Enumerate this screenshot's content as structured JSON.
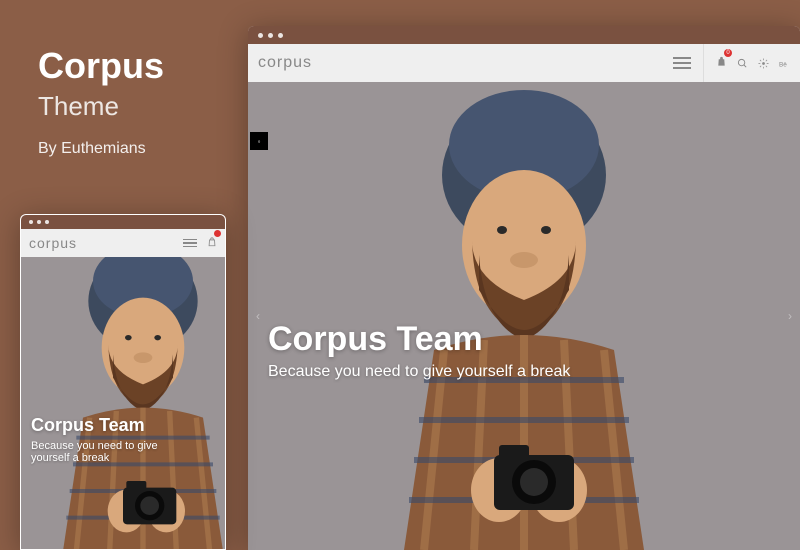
{
  "info": {
    "title": "Corpus",
    "subtitle": "Theme",
    "author": "By Euthemians"
  },
  "header": {
    "logo": "corpus",
    "cart_count": "0"
  },
  "hero": {
    "title": "Corpus Team",
    "subtitle": "Because you need to give yourself a break"
  },
  "mobile_hero": {
    "title": "Corpus Team",
    "subtitle": "Because you need to give yourself a break"
  }
}
